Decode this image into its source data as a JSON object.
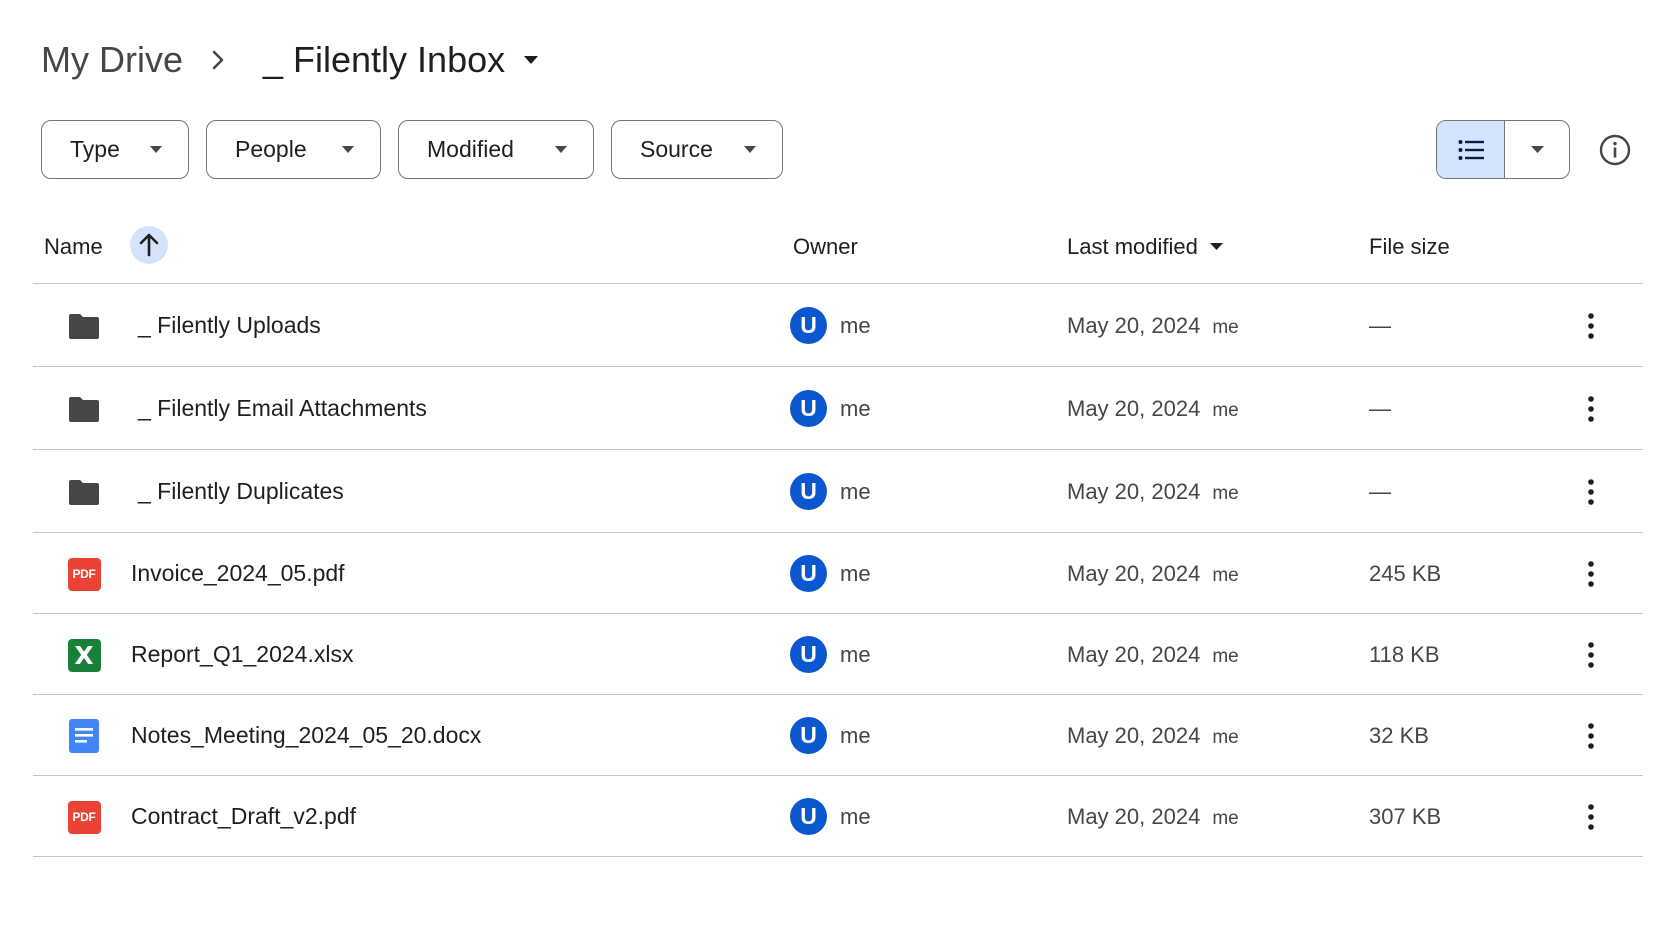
{
  "breadcrumb": {
    "root": "My Drive",
    "current": "_ Filently Inbox",
    "separator_icon": "chevron-right-icon",
    "current_caret_icon": "caret-down-icon"
  },
  "filters": [
    {
      "label": "Type"
    },
    {
      "label": "People"
    },
    {
      "label": "Modified"
    },
    {
      "label": "Source"
    }
  ],
  "view": {
    "active": "list",
    "list_icon": "list-view-icon",
    "more_icon": "caret-down-icon",
    "info_icon": "info-icon"
  },
  "table": {
    "columns": {
      "name": "Name",
      "owner": "Owner",
      "last_modified": "Last modified",
      "file_size": "File size"
    },
    "sort": {
      "column": "name",
      "direction": "ascending",
      "icon": "arrow-up-icon"
    },
    "rows": [
      {
        "type": "folder",
        "icon": "folder-icon",
        "name": "_ Filently Uploads",
        "owner_initial": "U",
        "owner": "me",
        "modified_date": "May 20, 2024",
        "modified_by": "me",
        "size": "—"
      },
      {
        "type": "folder",
        "icon": "folder-icon",
        "name": "_ Filently Email Attachments",
        "owner_initial": "U",
        "owner": "me",
        "modified_date": "May 20, 2024",
        "modified_by": "me",
        "size": "—"
      },
      {
        "type": "folder",
        "icon": "folder-icon",
        "name": "_ Filently Duplicates",
        "owner_initial": "U",
        "owner": "me",
        "modified_date": "May 20, 2024",
        "modified_by": "me",
        "size": "—"
      },
      {
        "type": "pdf",
        "icon": "pdf-icon",
        "icon_text": "PDF",
        "name": "Invoice_2024_05.pdf",
        "owner_initial": "U",
        "owner": "me",
        "modified_date": "May 20, 2024",
        "modified_by": "me",
        "size": "245 KB"
      },
      {
        "type": "xlsx",
        "icon": "excel-icon",
        "icon_text": "X",
        "name": "Report_Q1_2024.xlsx",
        "owner_initial": "U",
        "owner": "me",
        "modified_date": "May 20, 2024",
        "modified_by": "me",
        "size": "118 KB"
      },
      {
        "type": "docx",
        "icon": "docs-icon",
        "name": "Notes_Meeting_2024_05_20.docx",
        "owner_initial": "U",
        "owner": "me",
        "modified_date": "May 20, 2024",
        "modified_by": "me",
        "size": "32 KB"
      },
      {
        "type": "pdf",
        "icon": "pdf-icon",
        "icon_text": "PDF",
        "name": "Contract_Draft_v2.pdf",
        "owner_initial": "U",
        "owner": "me",
        "modified_date": "May 20, 2024",
        "modified_by": "me",
        "size": "307 KB"
      }
    ]
  },
  "colors": {
    "accent_light": "#d3e3fd",
    "avatar": "#0b57d0",
    "pdf": "#ea4335",
    "excel": "#188038",
    "docs": "#4285f4",
    "folder": "#444746",
    "divider": "#c4c7c5"
  }
}
